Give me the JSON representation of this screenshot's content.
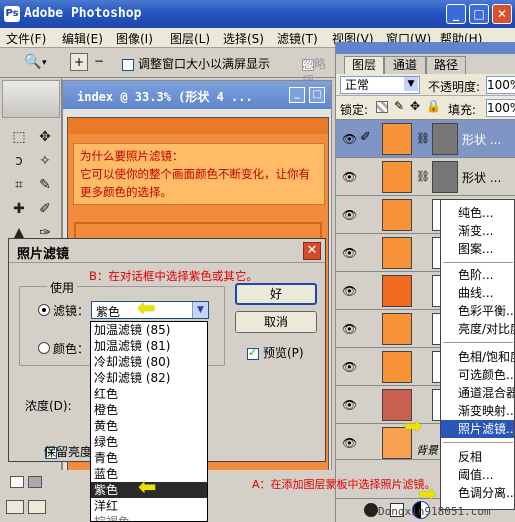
{
  "app": {
    "title": "Adobe Photoshop"
  },
  "menu": [
    "文件(F)",
    "编辑(E)",
    "图像(I)",
    "图层(L)",
    "选择(S)",
    "滤镜(T)",
    "视图(V)",
    "窗口(W)",
    "帮助(H)"
  ],
  "options_bar": {
    "fit_label": "调整窗口大小以满屏显示",
    "ignore_label": "忽略调"
  },
  "document": {
    "title": "index @ 33.3% (形状 4 ..."
  },
  "canvas_note": {
    "line1": "为什么要照片滤镜：",
    "line2": "它可以使你的整个画面颜色不断变化，让你有更多颜色的选择。"
  },
  "dialog": {
    "title": "照片滤镜",
    "hint": "B：在对话框中选择紫色或其它。",
    "group_label": "使用",
    "filter_label": "滤镜：",
    "filter_value": "紫色",
    "color_label": "颜色：",
    "ok_label": "好",
    "cancel_label": "取消",
    "preview_label": "预览(P)",
    "density_label": "浓度(D):",
    "keep_lum_label": "保留亮度"
  },
  "dropdown_options": [
    "加温滤镜 (85)",
    "加温滤镜 (81)",
    "冷却滤镜 (80)",
    "冷却滤镜 (82)",
    "红色",
    "橙色",
    "黄色",
    "绿色",
    "青色",
    "蓝色",
    "紫色",
    "洋红",
    "棕褐色"
  ],
  "dropdown_selected": "紫色",
  "layers_panel": {
    "tabs": [
      "图层",
      "通道",
      "路径"
    ],
    "blend_mode": "正常",
    "opacity_label": "不透明度:",
    "opacity_value": "100%",
    "lock_label": "锁定:",
    "fill_label": "填充:",
    "fill_value": "100%",
    "layer_names": [
      "形状 ...",
      "形状 ..."
    ],
    "bottom_label": "背景"
  },
  "context_menu": [
    "纯色...",
    "渐变...",
    "图案...",
    "色阶...",
    "曲线...",
    "色彩平衡...",
    "亮度/对比度...",
    "色相/饱和度...",
    "可选颜色...",
    "通道混合器...",
    "渐变映射...",
    "照片滤镜...",
    "反相",
    "阈值...",
    "色调分离..."
  ],
  "context_selected": "照片滤镜...",
  "annotation_a": "A：在添加图层蒙板中选择照片滤镜。",
  "watermark": "Dongxin918051.com",
  "colors": {
    "accent": "#2556c0",
    "note_red": "#e00000",
    "canvas": "#f28c3c",
    "arrow": "#e8e400"
  }
}
